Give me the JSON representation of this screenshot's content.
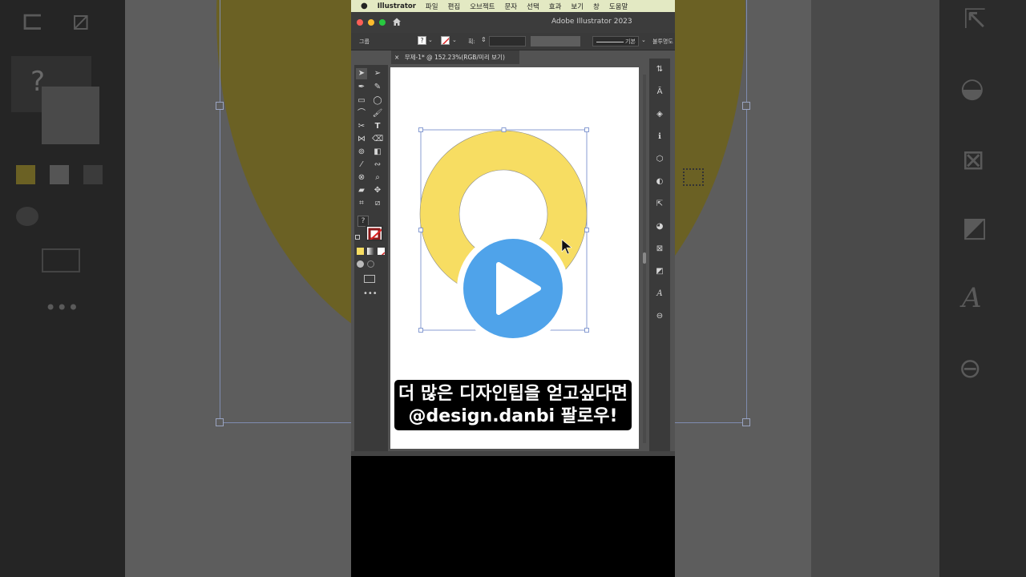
{
  "menubar": {
    "app_name": "Illustrator",
    "items": [
      "파일",
      "편집",
      "오브젝트",
      "문자",
      "선택",
      "효과",
      "보기",
      "창",
      "도움말"
    ]
  },
  "window": {
    "title": "Adobe Illustrator 2023"
  },
  "control_bar": {
    "selection_label": "그룹",
    "stroke_label": "획:",
    "stroke_style": "기본",
    "opacity_label": "불투명도"
  },
  "document_tab": {
    "close": "×",
    "label": "무제-1* @ 152.23%(RGB/미리 보기)"
  },
  "caption": {
    "line1": "더 많은 디자인팁을 얻고싶다면",
    "line2": "@design.danbi 팔로우!"
  },
  "colors": {
    "ring_fill": "#f7dd62",
    "play_button": "#4fa3ea",
    "menubar_bg": "#e3e9c3"
  },
  "icons": [
    "apple-icon",
    "home-icon",
    "play-icon",
    "selection-tool-icon",
    "direct-selection-icon",
    "pen-icon",
    "type-icon",
    "rectangle-icon",
    "ellipse-icon",
    "zoom-icon",
    "fill-color-icon",
    "stroke-color-icon",
    "more-icon"
  ]
}
